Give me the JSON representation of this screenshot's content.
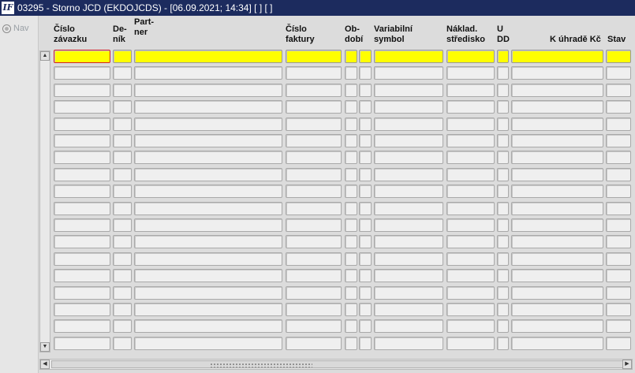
{
  "window": {
    "title": "03295 - Storno JCD (EKDOJCDS) - [06.09.2021; 14:34]  [ ]  [ ]",
    "app_icon": "IF"
  },
  "nav": {
    "label": "Nav"
  },
  "columns": [
    {
      "key": "cislo_zavazku",
      "line1": "Číslo",
      "line2": "závazku"
    },
    {
      "key": "denik",
      "line1": "De-",
      "line2": "ník"
    },
    {
      "key": "partner",
      "line1": "Part-",
      "line2": "ner"
    },
    {
      "key": "cislo_faktury",
      "line1": "Číslo",
      "line2": "faktury"
    },
    {
      "key": "obdobi",
      "line1": "Ob-",
      "line2": "dobí"
    },
    {
      "key": "obdobi2",
      "line1": "",
      "line2": ""
    },
    {
      "key": "variabilni_symbol",
      "line1": "Variabilní",
      "line2": "symbol"
    },
    {
      "key": "naklad_stredisko",
      "line1": "Náklad.",
      "line2": "středisko"
    },
    {
      "key": "udd",
      "line1": "U",
      "line2": "DD"
    },
    {
      "key": "k_uhrade",
      "line1": "",
      "line2": "K úhradě Kč"
    },
    {
      "key": "stav",
      "line1": "",
      "line2": "Stav"
    }
  ],
  "grid": {
    "row_count": 18,
    "current_row_color": "#ffff00",
    "focus_color": "#d0202a"
  },
  "scrollbars": {
    "up_icon": "triangle-up-icon",
    "down_icon": "triangle-down-icon",
    "left_icon": "triangle-left-icon",
    "right_icon": "triangle-right-icon"
  }
}
